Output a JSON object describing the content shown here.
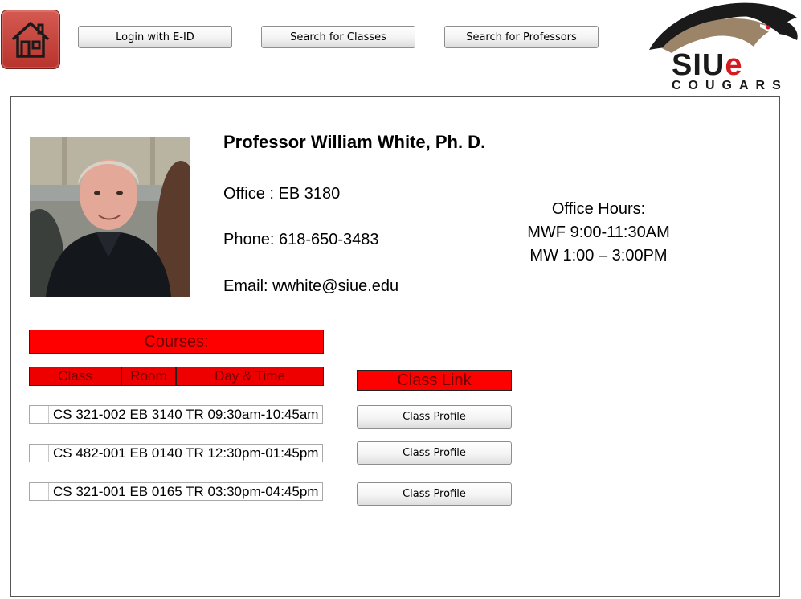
{
  "nav": {
    "login_label": "Login with E-ID",
    "search_classes_label": "Search for Classes",
    "search_professors_label": "Search for Professors"
  },
  "logo": {
    "word_main": "SIU",
    "word_accent": "e",
    "subtitle": "COUGARS"
  },
  "professor": {
    "name": "Professor William White, Ph. D.",
    "office": "Office : EB 3180",
    "phone": "Phone: 618-650-3483",
    "email": "Email: wwhite@siue.edu"
  },
  "office_hours": {
    "heading": "Office Hours:",
    "line1": "MWF 9:00-11:30AM",
    "line2": "MW 1:00 – 3:00PM"
  },
  "courses": {
    "heading": "Courses:",
    "columns": [
      "Class",
      "Room",
      "Day & Time"
    ],
    "link_heading": "Class Link",
    "rows": [
      {
        "text": "CS 321-002  EB 3140  TR 09:30am-10:45am",
        "link_label": "Class Profile"
      },
      {
        "text": "CS 482-001  EB 0140  TR 12:30pm-01:45pm",
        "link_label": "Class Profile"
      },
      {
        "text": "CS 321-001  EB 0165  TR 03:30pm-04:45pm",
        "link_label": "Class Profile"
      }
    ]
  },
  "colors": {
    "accent_red": "#ff0000",
    "home_red": "#c8453d",
    "brand_gold": "#9c8468"
  }
}
